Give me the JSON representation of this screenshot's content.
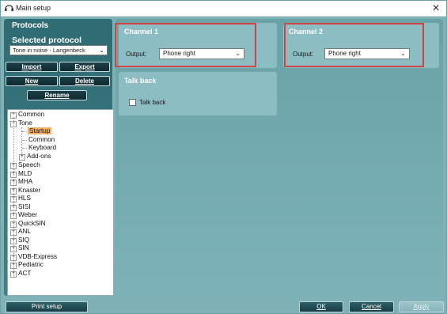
{
  "window": {
    "title": "Main setup",
    "close_glyph": "✕",
    "app_icon": "headphones-icon"
  },
  "left_panel": {
    "header": "Protocols",
    "selected_protocol_label": "Selected protocol",
    "selected_protocol_value": "Tone in noise - Langenbeck",
    "buttons": {
      "import": "Import",
      "export": "Export",
      "new": "New",
      "delete": "Delete",
      "rename": "Rename"
    },
    "tree": {
      "common": "Common",
      "tone": "Tone",
      "tone_children": {
        "startup": "Startup",
        "common": "Common",
        "keyboard": "Keyboard",
        "addons": "Add-ons"
      },
      "speech": "Speech",
      "mld": "MLD",
      "mha": "MHA",
      "knaster": "Knaster",
      "hls": "HLS",
      "sisi": "SISI",
      "weber": "Weber",
      "quicksin": "QuickSIN",
      "anl": "ANL",
      "siq": "SIQ",
      "sin": "SIN",
      "vdb": "VDB-Express",
      "pediatric": "Pediatric",
      "act": "ACT"
    },
    "selected_node": "Startup"
  },
  "channel1": {
    "title": "Channel 1",
    "output_label": "Output:",
    "output_value": "Phone right"
  },
  "channel2": {
    "title": "Channel 2",
    "output_label": "Output:",
    "output_value": "Phone right"
  },
  "talkback": {
    "title": "Talk back",
    "checkbox_label": "Talk back",
    "checked": false
  },
  "footer": {
    "print_setup": "Print setup",
    "ok": "OK",
    "cancel": "Cancel",
    "apply": "Apply"
  },
  "colors": {
    "window_bg": "#7fb2b7",
    "left_panel_bg": "#2f6b73",
    "panel_bg": "#8cbdc2",
    "highlight": "#d04444",
    "selected_node": "#f5b26b"
  }
}
